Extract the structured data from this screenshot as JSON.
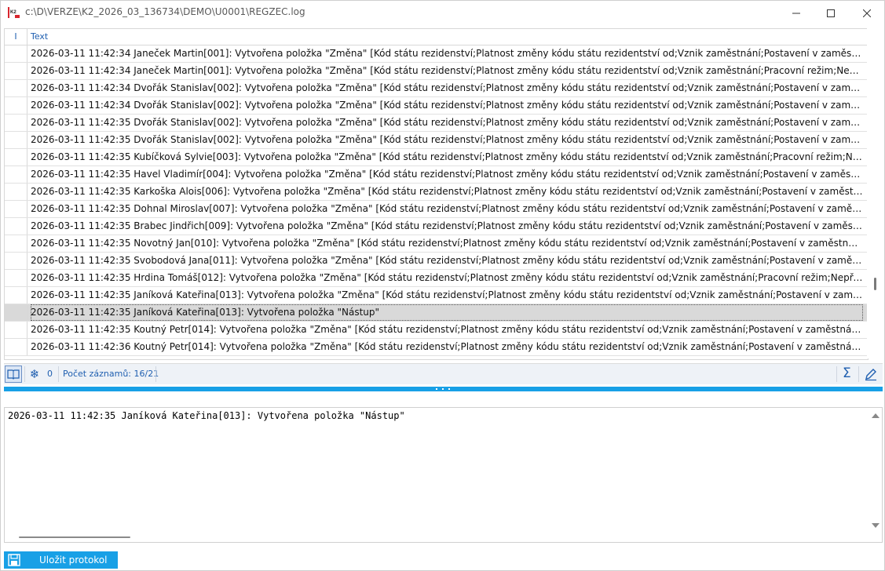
{
  "window": {
    "title": "c:\\D\\VERZE\\K2_2026_03_136734\\DEMO\\U0001\\REGZEC.log",
    "app_icon": "k2-app-icon",
    "app_icon_text": "K2"
  },
  "grid": {
    "columns": [
      "I",
      "Text"
    ],
    "rows": [
      "2026-03-11 11:42:34 Janeček Martin[001]: Vytvořena položka \"Změna\" [Kód státu rezidenství;Platnost změny kódu státu rezidentství od;Vznik zaměstnání;Postavení v zaměstnání (CZ-ISCO)",
      "2026-03-11 11:42:34 Janeček Martin[001]: Vytvořena položka \"Změna\" [Kód státu rezidenství;Platnost změny kódu státu rezidentství od;Vznik zaměstnání;Pracovní režim;Nepřetržitý provoz",
      "2026-03-11 11:42:34 Dvořák Stanislav[002]: Vytvořena položka \"Změna\" [Kód státu rezidenství;Platnost změny kódu státu rezidentství od;Vznik zaměstnání;Postavení v zaměstnání (CZ-ISCO)",
      "2026-03-11 11:42:34 Dvořák Stanislav[002]: Vytvořena položka \"Změna\" [Kód státu rezidenství;Platnost změny kódu státu rezidentství od;Vznik zaměstnání;Postavení v zaměstnání (CZ-ISCO)",
      "2026-03-11 11:42:35 Dvořák Stanislav[002]: Vytvořena položka \"Změna\" [Kód státu rezidenství;Platnost změny kódu státu rezidentství od;Vznik zaměstnání;Postavení v zaměstnání (CZ-ISCO)",
      "2026-03-11 11:42:35 Dvořák Stanislav[002]: Vytvořena položka \"Změna\" [Kód státu rezidenství;Platnost změny kódu státu rezidentství od;Vznik zaměstnání;Postavení v zaměstnání (CZ-ISCO)",
      "2026-03-11 11:42:35 Kubíčková Sylvie[003]: Vytvořena položka \"Změna\" [Kód státu rezidenství;Platnost změny kódu státu rezidentství od;Vznik zaměstnání;Pracovní režim;Nepřetržitý provoz",
      "2026-03-11 11:42:35 Havel Vladimír[004]: Vytvořena položka \"Změna\" [Kód státu rezidenství;Platnost změny kódu státu rezidentství od;Vznik zaměstnání;Postavení v zaměstnání (CZ-ISCO)",
      "2026-03-11 11:42:35 Karkoška Alois[006]: Vytvořena položka \"Změna\" [Kód státu rezidenství;Platnost změny kódu státu rezidentství od;Vznik zaměstnání;Postavení v zaměstnání (CZ-ISCO)",
      "2026-03-11 11:42:35 Dohnal Miroslav[007]: Vytvořena položka \"Změna\" [Kód státu rezidenství;Platnost změny kódu státu rezidentství od;Vznik zaměstnání;Postavení v zaměstnání (CZ-ISCO)",
      "2026-03-11 11:42:35 Brabec Jindřich[009]: Vytvořena položka \"Změna\" [Kód státu rezidenství;Platnost změny kódu státu rezidentství od;Vznik zaměstnání;Postavení v zaměstnání (CZ-ISCO)",
      "2026-03-11 11:42:35 Novotný Jan[010]: Vytvořena položka \"Změna\" [Kód státu rezidenství;Platnost změny kódu státu rezidentství od;Vznik zaměstnání;Postavení v zaměstnání (CZ-ISCO)",
      "2026-03-11 11:42:35 Svobodová Jana[011]: Vytvořena položka \"Změna\" [Kód státu rezidenství;Platnost změny kódu státu rezidentství od;Vznik zaměstnání;Postavení v zaměstnání (CZ-ISCO)",
      "2026-03-11 11:42:35 Hrdina Tomáš[012]: Vytvořena položka \"Změna\" [Kód státu rezidenství;Platnost změny kódu státu rezidentství od;Vznik zaměstnání;Pracovní režim;Nepřetržitý provoz",
      "2026-03-11 11:42:35 Janíková Kateřina[013]: Vytvořena položka \"Změna\" [Kód státu rezidenství;Platnost změny kódu státu rezidentství od;Vznik zaměstnání;Postavení v zaměstnání (CZ-ISCO)",
      "2026-03-11 11:42:35 Janíková Kateřina[013]: Vytvořena položka \"Nástup\"",
      "2026-03-11 11:42:35 Koutný Petr[014]: Vytvořena položka \"Změna\" [Kód státu rezidenství;Platnost změny kódu státu rezidentství od;Vznik zaměstnání;Postavení v zaměstnání (CZ-ISCO)",
      "2026-03-11 11:42:36 Koutný Petr[014]: Vytvořena položka \"Změna\" [Kód státu rezidenství;Platnost změny kódu státu rezidentství od;Vznik zaměstnání;Postavení v zaměstnání (CZ-ISCO)"
    ],
    "selected_row_index": 15
  },
  "statusbar": {
    "filter_count": "0",
    "records": "Počet záznamů: 16/21"
  },
  "detail": {
    "text": "2026-03-11 11:42:35 Janíková Kateřina[013]: Vytvořena položka \"Nástup\""
  },
  "footer": {
    "save_label": "Uložit protokol"
  },
  "colors": {
    "accent": "#18a0e6",
    "link_text": "#1f5fb0",
    "selection": "#d9d9d9"
  }
}
